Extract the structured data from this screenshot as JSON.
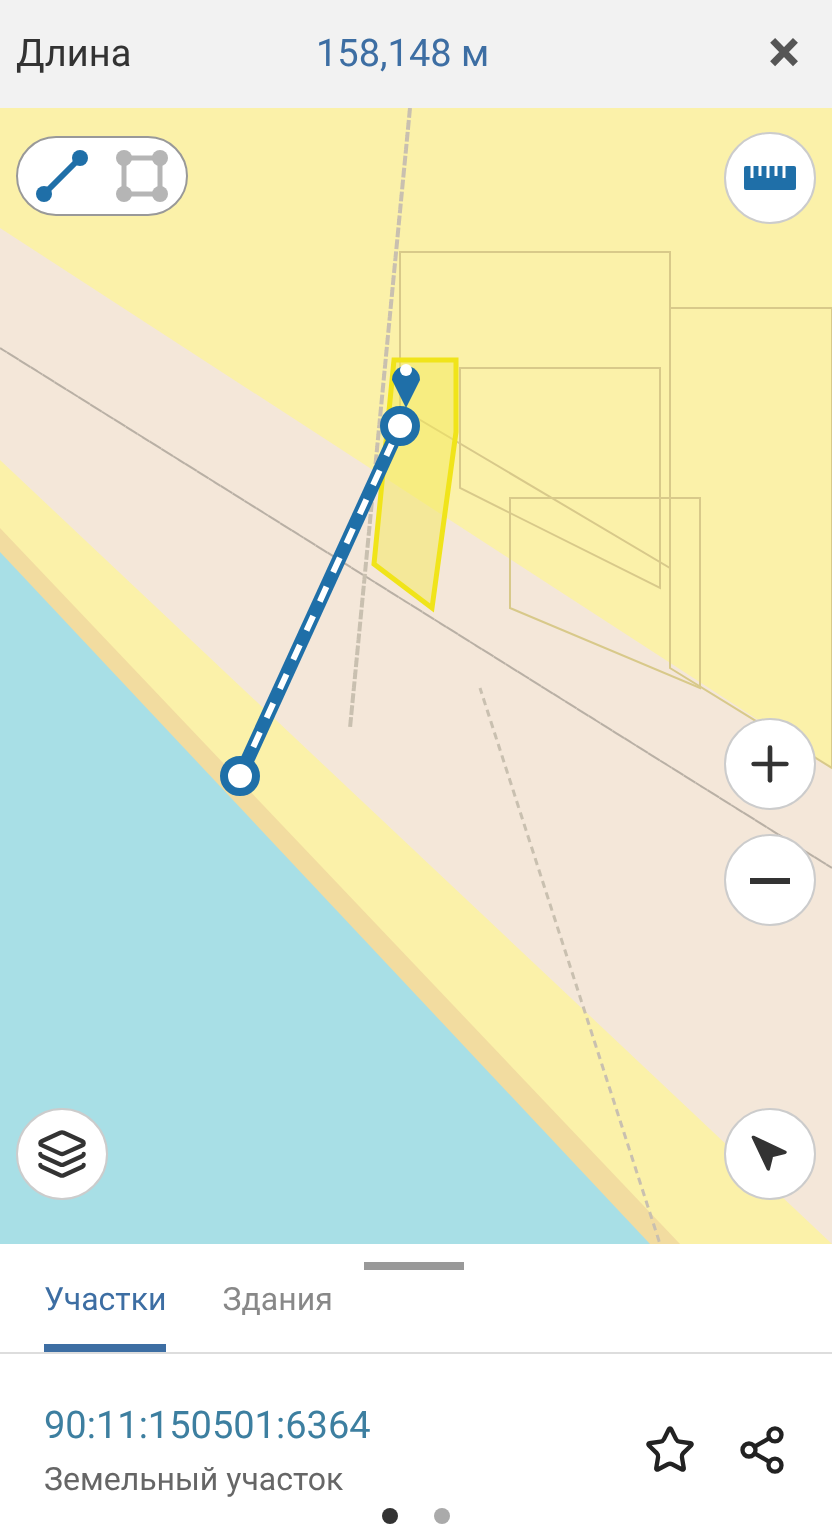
{
  "header": {
    "label": "Длина",
    "value": "158,148 м",
    "close": "×"
  },
  "modes": [
    {
      "kind": "line",
      "selected": true
    },
    {
      "kind": "polygon",
      "selected": false
    }
  ],
  "tabs": [
    {
      "label": "Участки",
      "selected": true
    },
    {
      "label": "Здания",
      "selected": false
    }
  ],
  "parcel": {
    "number": "90:11:150501:6364",
    "type": "Земельный участок"
  },
  "pager": [
    {
      "selected": true
    },
    {
      "selected": false
    }
  ]
}
